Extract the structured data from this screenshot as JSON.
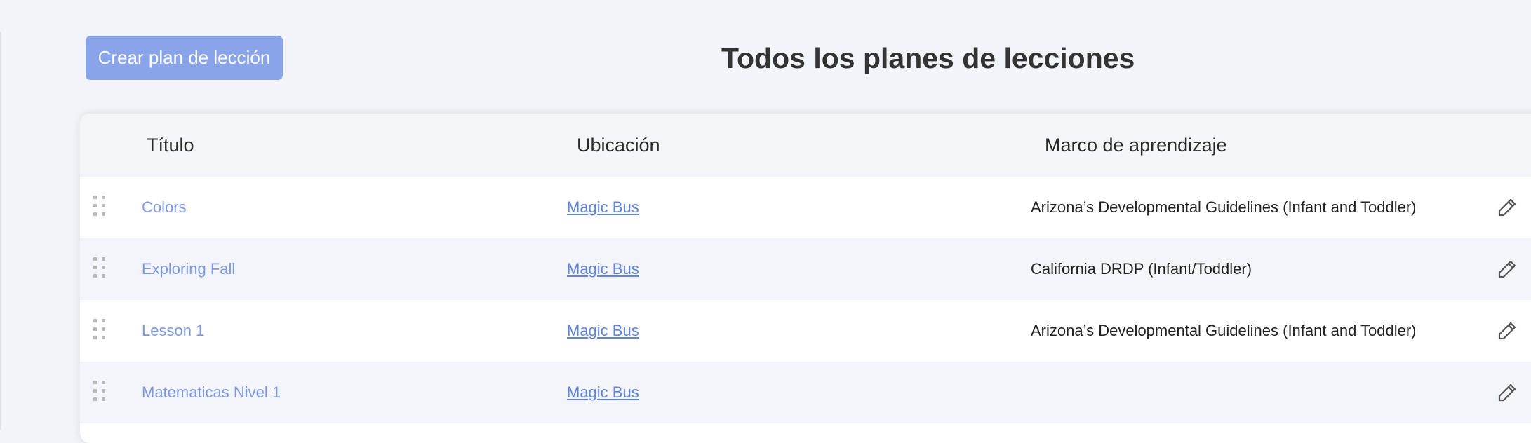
{
  "header": {
    "create_button_label": "Crear plan de lección",
    "page_title": "Todos los planes de lecciones"
  },
  "table": {
    "columns": [
      "Título",
      "Ubicación",
      "Marco de aprendizaje"
    ],
    "rows": [
      {
        "title": "Colors",
        "location": "Magic Bus",
        "framework": "Arizona’s Developmental Guidelines (Infant and Toddler)"
      },
      {
        "title": "Exploring Fall",
        "location": "Magic Bus",
        "framework": "California DRDP (Infant/Toddler)"
      },
      {
        "title": "Lesson 1",
        "location": "Magic Bus",
        "framework": "Arizona’s Developmental Guidelines (Infant and Toddler)"
      },
      {
        "title": "Matematicas Nivel 1",
        "location": "Magic Bus",
        "framework": ""
      }
    ]
  },
  "icons": {
    "drag": "drag-handle-icon",
    "edit": "pencil-icon",
    "extra": "trash-icon"
  },
  "colors": {
    "accent": "#8aa4ea",
    "link": "#5e83e0",
    "title_link": "#7b98e4",
    "background": "#f3f4f9"
  }
}
